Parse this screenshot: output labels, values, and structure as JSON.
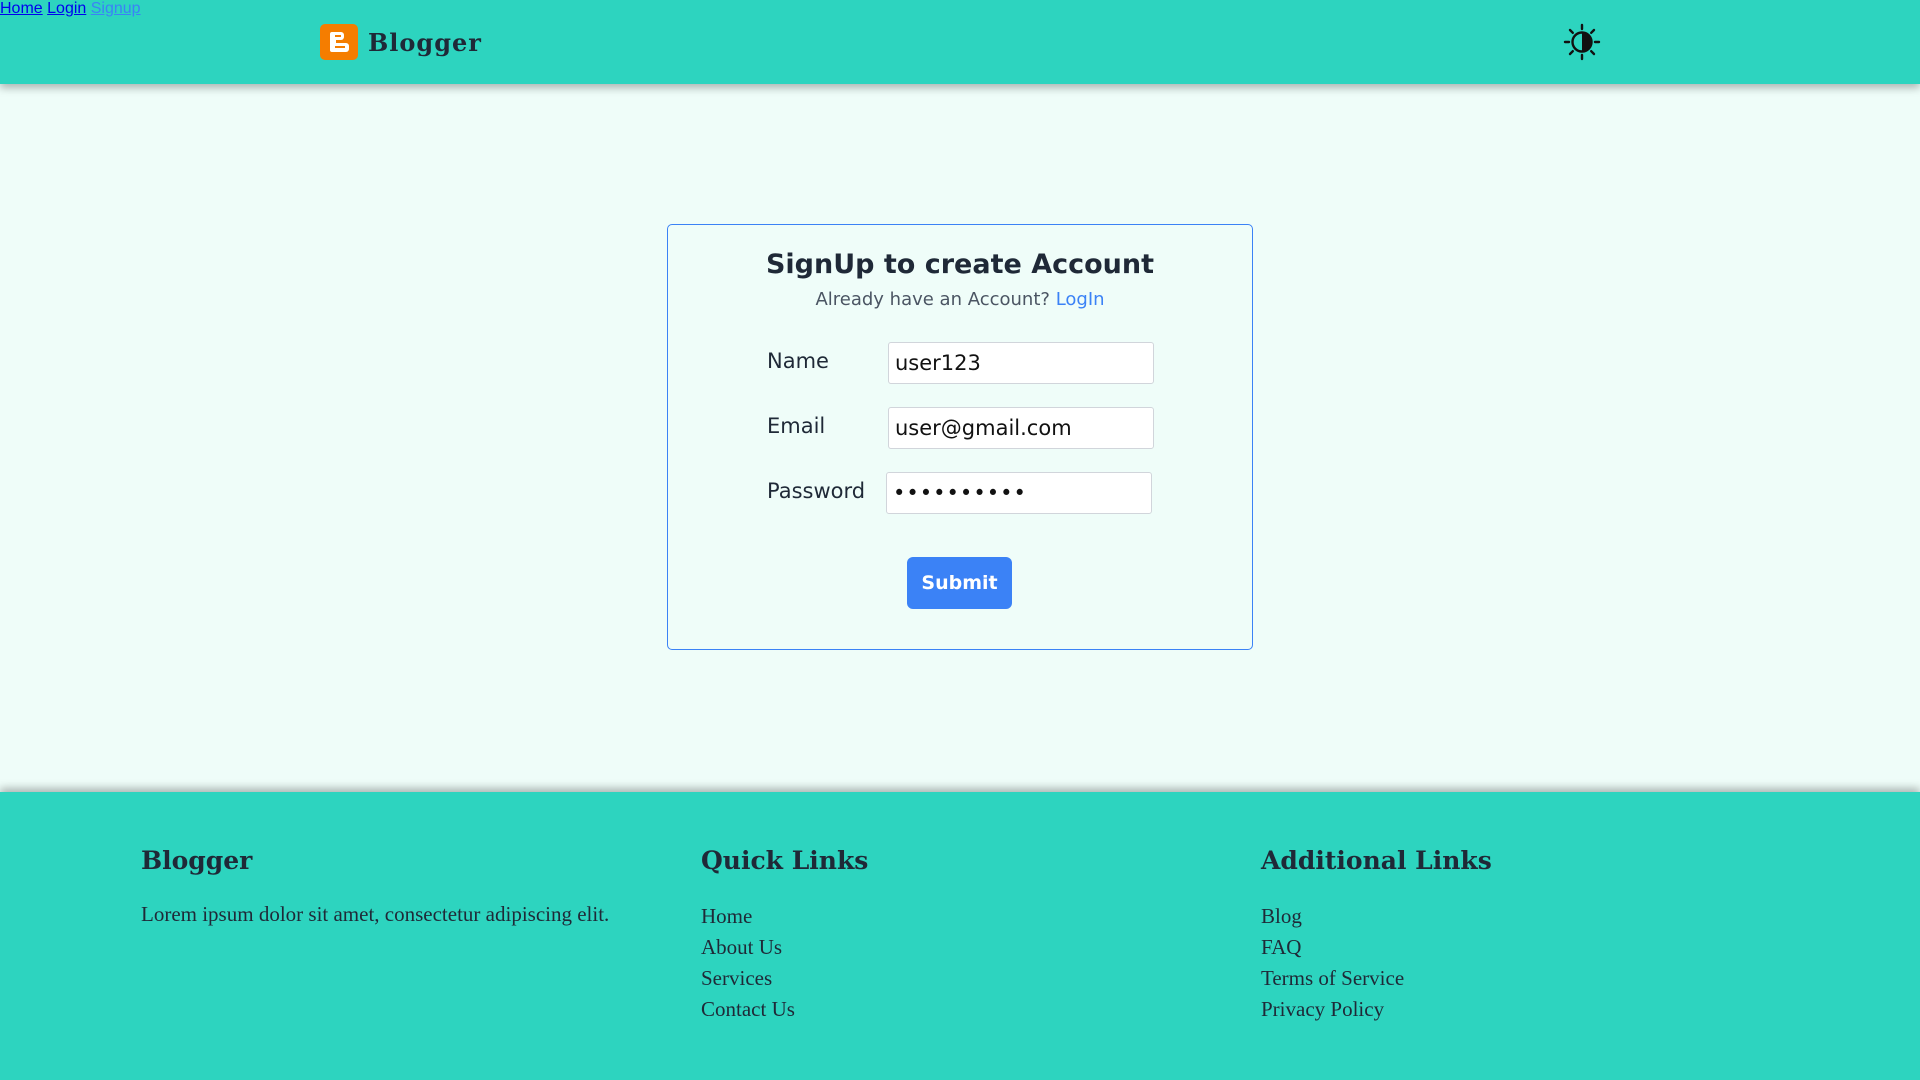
{
  "header": {
    "brand": "Blogger",
    "brand_logo_icon": "blogger-b-icon",
    "nav": [
      {
        "label": "Home",
        "active": false
      },
      {
        "label": "Login",
        "active": false
      },
      {
        "label": "Signup",
        "active": true
      }
    ],
    "theme_toggle_icon": "brightness-contrast-icon"
  },
  "signup": {
    "title": "SignUp to create Account",
    "subtitle_text": "Already have an Account?",
    "login_link": "LogIn",
    "fields": {
      "name": {
        "label": "Name",
        "value": "user123"
      },
      "email": {
        "label": "Email",
        "value": "user@gmail.com"
      },
      "password": {
        "label": "Password",
        "value": "••••••••••"
      }
    },
    "submit_label": "Submit"
  },
  "footer": {
    "about": {
      "title": "Blogger",
      "text": "Lorem ipsum dolor sit amet, consectetur adipiscing elit."
    },
    "quick_links": {
      "title": "Quick Links",
      "items": [
        "Home",
        "About Us",
        "Services",
        "Contact Us"
      ]
    },
    "additional_links": {
      "title": "Additional Links",
      "items": [
        "Blog",
        "FAQ",
        "Terms of Service",
        "Privacy Policy"
      ]
    }
  },
  "colors": {
    "primary_teal": "#2dd4bf",
    "page_background": "#effdf9",
    "accent_blue": "#3b82f6",
    "logo_orange": "#f57d00"
  }
}
